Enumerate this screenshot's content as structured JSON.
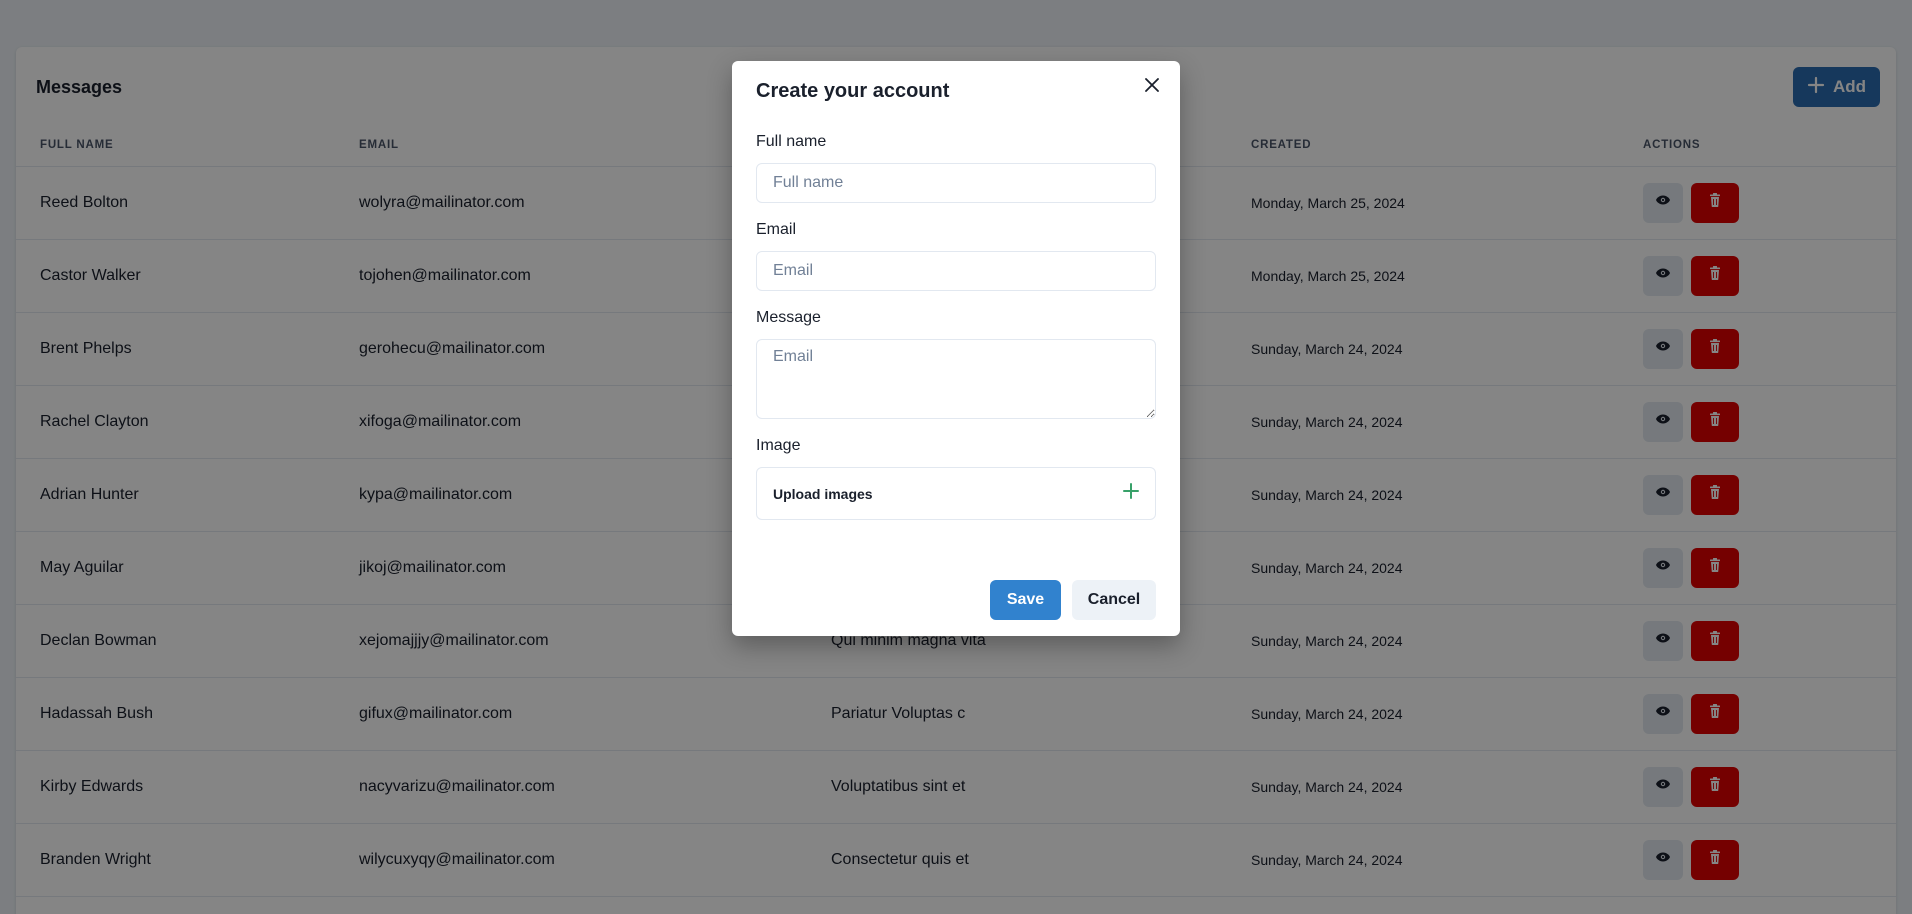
{
  "page": {
    "title": "Messages",
    "add_label": "Add"
  },
  "table": {
    "headers": [
      "FULL NAME",
      "EMAIL",
      "",
      "CREATED",
      "ACTIONS"
    ],
    "rows": [
      {
        "name": "Reed Bolton",
        "email": "wolyra@mailinator.com",
        "message": "",
        "created": "Monday, March 25, 2024"
      },
      {
        "name": "Castor Walker",
        "email": "tojohen@mailinator.com",
        "message": "",
        "created": "Monday, March 25, 2024"
      },
      {
        "name": "Brent Phelps",
        "email": "gerohecu@mailinator.com",
        "message": "",
        "created": "Sunday, March 24, 2024"
      },
      {
        "name": "Rachel Clayton",
        "email": "xifoga@mailinator.com",
        "message": "",
        "created": "Sunday, March 24, 2024"
      },
      {
        "name": "Adrian Hunter",
        "email": "kypa@mailinator.com",
        "message": "",
        "created": "Sunday, March 24, 2024"
      },
      {
        "name": "May Aguilar",
        "email": "jikoj@mailinator.com",
        "message": "",
        "created": "Sunday, March 24, 2024"
      },
      {
        "name": "Declan Bowman",
        "email": "xejomajjjy@mailinator.com",
        "message": "Qui minim magna vita",
        "created": "Sunday, March 24, 2024"
      },
      {
        "name": "Hadassah Bush",
        "email": "gifux@mailinator.com",
        "message": "Pariatur Voluptas c",
        "created": "Sunday, March 24, 2024"
      },
      {
        "name": "Kirby Edwards",
        "email": "nacyvarizu@mailinator.com",
        "message": "Voluptatibus sint et",
        "created": "Sunday, March 24, 2024"
      },
      {
        "name": "Branden Wright",
        "email": "wilycuxyqy@mailinator.com",
        "message": "Consectetur quis et",
        "created": "Sunday, March 24, 2024"
      }
    ]
  },
  "modal": {
    "title": "Create your account",
    "full_name_label": "Full name",
    "full_name_placeholder": "Full name",
    "full_name_value": "",
    "email_label": "Email",
    "email_placeholder": "Email",
    "email_value": "",
    "message_label": "Message",
    "message_placeholder": "Email",
    "message_value": "",
    "image_label": "Image",
    "upload_label": "Upload images",
    "save_label": "Save",
    "cancel_label": "Cancel"
  },
  "icons": {
    "add": "plus-icon",
    "view": "eye-icon",
    "delete": "trash-icon",
    "close": "close-icon",
    "upload": "plus-icon"
  },
  "colors": {
    "primary": "#2b6cb0",
    "save": "#3182ce",
    "danger": "#e00000",
    "upload_plus": "#38a169"
  }
}
